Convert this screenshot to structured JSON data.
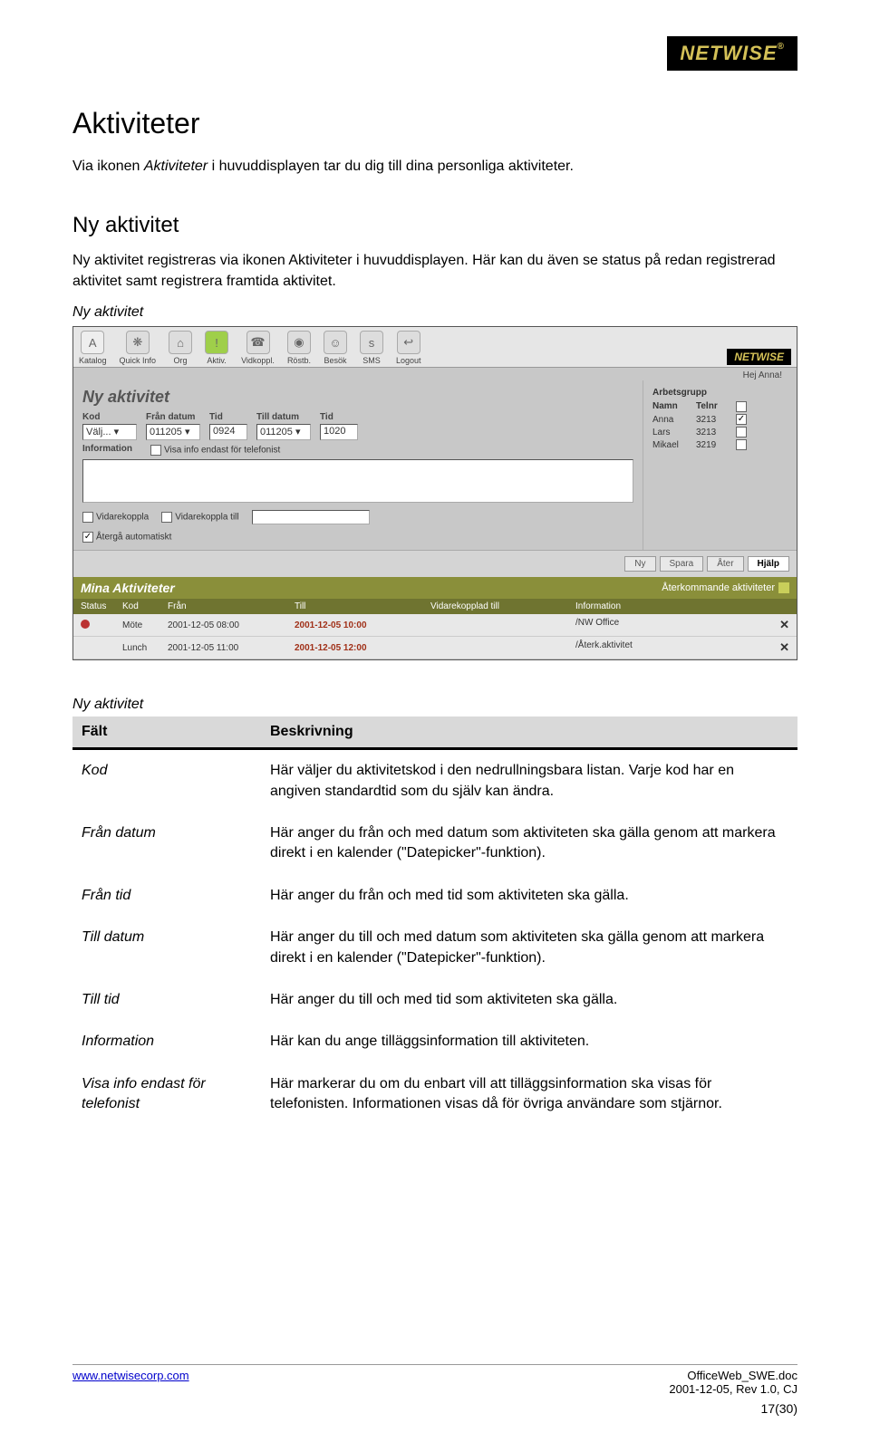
{
  "brand": "NETWISE",
  "heading1": "Aktiviteter",
  "intro_pre": "Via ikonen ",
  "intro_em": "Aktiviteter",
  "intro_post": " i huvuddisplayen tar du dig till dina personliga aktiviteter.",
  "heading2": "Ny aktivitet",
  "para2_pre": "Ny aktivitet registreras via ikonen ",
  "para2_em": "Aktiviteter",
  "para2_post": " i huvuddisplayen. Här kan du även se status på redan registrerad aktivitet samt registrera framtida aktivitet.",
  "caption_shot": "Ny aktivitet",
  "shot": {
    "toolbar": {
      "items": [
        "Katalog",
        "Quick Info",
        "Org",
        "Aktiv.",
        "Vidkoppl.",
        "Röstb.",
        "Besök",
        "SMS",
        "Logout"
      ],
      "greet": "Hej Anna!"
    },
    "form": {
      "title": "Ny aktivitet",
      "kod_label": "Kod",
      "kod_value": "Välj...",
      "fran_datum_label": "Från datum",
      "fran_datum_value": "011205",
      "fran_tid_label": "Tid",
      "fran_tid_value": "0924",
      "till_datum_label": "Till datum",
      "till_datum_value": "011205",
      "till_tid_label": "Tid",
      "till_tid_value": "1020",
      "info_label": "Information",
      "visa_info_label": "Visa info endast för telefonist",
      "vk_label": "Vidarekoppla",
      "vkt_label": "Vidarekoppla till",
      "aterga_label": "Återgå automatiskt"
    },
    "arbetsgrupp": {
      "title": "Arbetsgrupp",
      "head_name": "Namn",
      "head_tel": "Telnr",
      "rows": [
        {
          "name": "Anna",
          "tel": "3213",
          "checked": true
        },
        {
          "name": "Lars",
          "tel": "3213",
          "checked": false
        },
        {
          "name": "Mikael",
          "tel": "3219",
          "checked": false
        }
      ]
    },
    "buttons": {
      "ny": "Ny",
      "spara": "Spara",
      "ater": "Åter",
      "hjalp": "Hjälp"
    },
    "mina": {
      "title": "Mina Aktiviteter",
      "recur": "Återkommande aktiviteter",
      "headers": [
        "Status",
        "Kod",
        "Från",
        "Till",
        "Vidarekopplad till",
        "Information"
      ],
      "rows": [
        {
          "status": "dot",
          "kod": "Möte",
          "fran": "2001-12-05 08:00",
          "till": "2001-12-05 10:00",
          "vk": "",
          "info": "/NW Office"
        },
        {
          "status": "",
          "kod": "Lunch",
          "fran": "2001-12-05 11:00",
          "till": "2001-12-05 12:00",
          "vk": "",
          "info": "/Återk.aktivitet"
        }
      ]
    }
  },
  "table_caption": "Ny aktivitet",
  "table_head_field": "Fält",
  "table_head_desc": "Beskrivning",
  "rows": [
    {
      "field": "Kod",
      "desc": "Här väljer du aktivitetskod i den nedrullningsbara listan. Varje kod har en angiven standardtid som du själv kan ändra."
    },
    {
      "field": "Från datum",
      "desc": "Här anger du från och med datum som aktiviteten ska gälla genom att markera direkt i en kalender (\"Datepicker\"-funktion)."
    },
    {
      "field": "Från tid",
      "desc": "Här anger du från och med tid som aktiviteten ska gälla."
    },
    {
      "field": "Till datum",
      "desc": "Här anger du till och med datum som aktiviteten ska gälla genom att markera direkt i en kalender (\"Datepicker\"-funktion)."
    },
    {
      "field": "Till tid",
      "desc": "Här anger du till och med tid som aktiviteten ska gälla."
    },
    {
      "field": "Information",
      "desc": "Här kan du ange tilläggsinformation till aktiviteten."
    },
    {
      "field": "Visa info endast för telefonist",
      "desc": "Här markerar du om du enbart vill att tilläggsinformation ska visas för telefonisten. Informationen visas då för övriga användare som stjärnor."
    }
  ],
  "footer": {
    "url": "www.netwisecorp.com",
    "doc": "OfficeWeb_SWE.doc",
    "rev": "2001-12-05, Rev 1.0, CJ",
    "page": "17(30)"
  }
}
